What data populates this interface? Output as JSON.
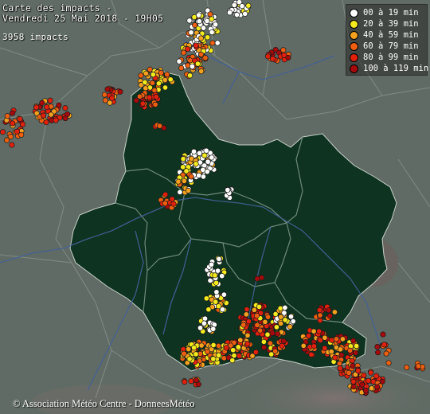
{
  "map": {
    "title_line1": "Carte des impacts -",
    "title_line2": "Vendredi 25 Mai 2018 - 19H05",
    "impact_count": "3958 impacts",
    "credit": "© Association Météo Centre - DonneesMétéo"
  },
  "legend": {
    "items": [
      {
        "label": "00 à 19 min",
        "color": "#ffffff"
      },
      {
        "label": "20 à 39 min",
        "color": "#f4ea1e"
      },
      {
        "label": "40 à 59 min",
        "color": "#f4a21e"
      },
      {
        "label": "60 à 79 min",
        "color": "#ee6010"
      },
      {
        "label": "80 à 99 min",
        "color": "#e2200c"
      },
      {
        "label": "100 à 119 min",
        "color": "#a70a0a"
      }
    ]
  },
  "colors": {
    "background_land": "#5f6b64",
    "region_fill": "#0e3320",
    "river": "#43619a",
    "border": "#8a948f"
  }
}
